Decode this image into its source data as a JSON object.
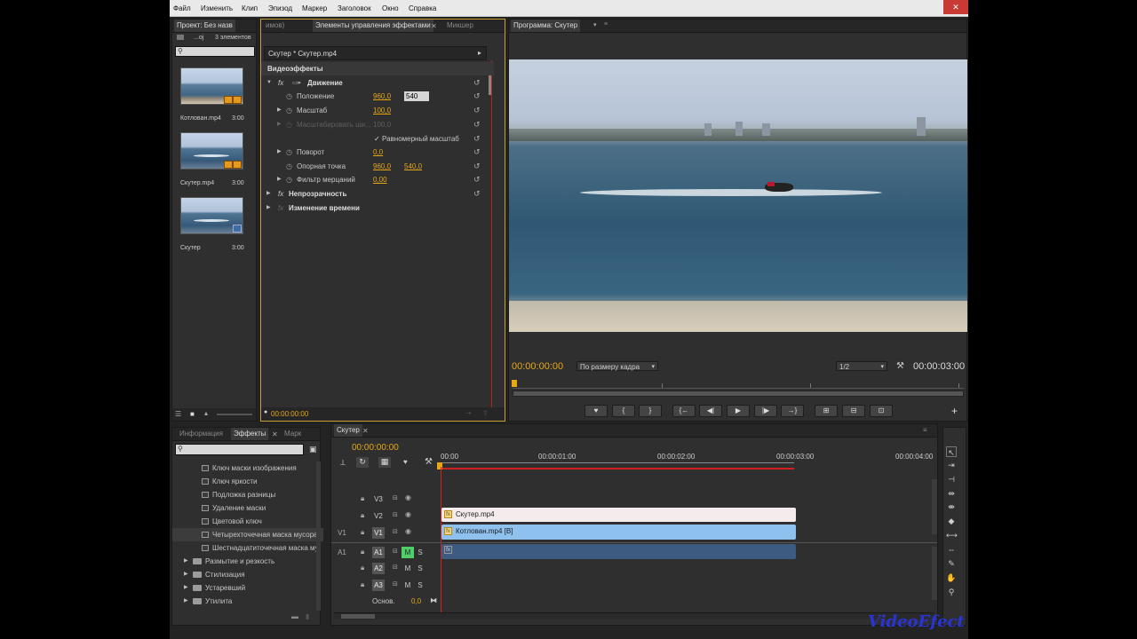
{
  "menu": [
    "Файл",
    "Изменить",
    "Клип",
    "Эпизод",
    "Маркер",
    "Заголовок",
    "Окно",
    "Справка"
  ],
  "window_close": "✕",
  "project": {
    "tab": "Проект: Без назв",
    "count_prefix": "...oj",
    "count": "3 элементов",
    "items": [
      {
        "name": "Котлован.mp4",
        "duration": "3:00"
      },
      {
        "name": "Скутер.mp4",
        "duration": "3:00"
      },
      {
        "name": "Скутер",
        "duration": "3:00"
      }
    ]
  },
  "effect_controls": {
    "tabs": [
      "имов)",
      "Элементы управления эффектами",
      "Микшер"
    ],
    "clip_path": "Скутер * Скутер.mp4",
    "section": "Видеоэффекты",
    "motion": "Движение",
    "position_label": "Положение",
    "position_x": "960,0",
    "position_y": "540",
    "scale_label": "Масштаб",
    "scale_value": "100,0",
    "scale_width_label": "Масштабировать ши...",
    "scale_width_value": "100,0",
    "uniform_scale": "Равномерный масштаб",
    "rotation_label": "Поворот",
    "rotation_value": "0,0",
    "anchor_label": "Опорная точка",
    "anchor_x": "960,0",
    "anchor_y": "540,0",
    "flicker_label": "Фильтр мерцаний",
    "flicker_value": "0,00",
    "opacity": "Непрозрачность",
    "time_remap": "Изменение времени",
    "timecode": "00:00:00:00"
  },
  "program": {
    "tab": "Программа: Скутер",
    "timecode": "00:00:00:00",
    "fit": "По размеру кадра",
    "resolution": "1/2",
    "duration": "00:00:03:00"
  },
  "effects_panel": {
    "tabs": [
      "Информация",
      "Эффекты",
      "Марк"
    ],
    "items": [
      "Ключ маски изображения",
      "Ключ яркости",
      "Подложка разницы",
      "Удаление маски",
      "Цветовой ключ",
      "Четырехточечная маска мусора",
      "Шестнадцатиточечная маска му"
    ],
    "folders": [
      "Размытие и резкость",
      "Стилизация",
      "Устаревший",
      "Утилита"
    ]
  },
  "timeline": {
    "tab": "Скутер",
    "timecode": "00:00:00:00",
    "ruler": [
      "00:00",
      "00:00:01:00",
      "00:00:02:00",
      "00:00:03:00",
      "00:00:04:00"
    ],
    "tracks": {
      "v3": "V3",
      "v2": "V2",
      "v1": "V1",
      "v1src": "V1",
      "a1": "A1",
      "a1src": "A1",
      "a2": "A2",
      "a3": "A3",
      "master": "Основ.",
      "master_val": "0,0",
      "m": "M",
      "s": "S"
    },
    "clips": {
      "v2": "Скутер.mp4",
      "v1": "Котлован.mp4 [В]"
    }
  },
  "watermark": "VideoEfect",
  "colors": {
    "accent": "#e6a817",
    "clip_v2": "#f4ecec",
    "clip_v1": "#8fc1ef",
    "clip_a1": "#3d5a80",
    "playhead": "#d02020"
  }
}
